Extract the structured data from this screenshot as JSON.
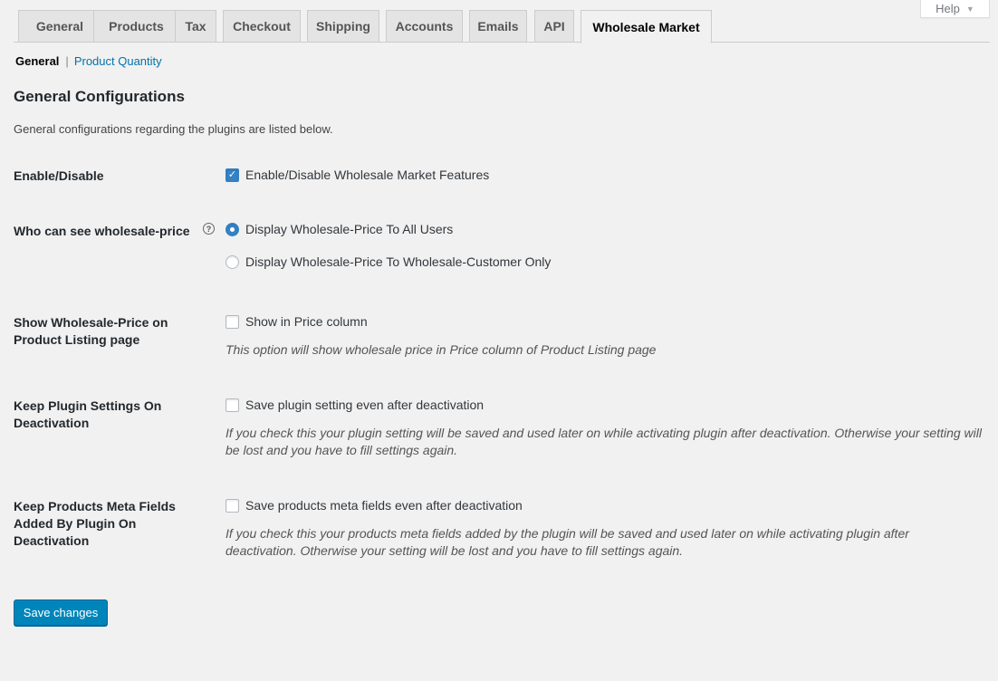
{
  "help": {
    "label": "Help"
  },
  "tabs": [
    {
      "label": "General",
      "active": false
    },
    {
      "label": "Products",
      "active": false
    },
    {
      "label": "Tax",
      "active": false
    },
    {
      "label": "Checkout",
      "active": false
    },
    {
      "label": "Shipping",
      "active": false
    },
    {
      "label": "Accounts",
      "active": false
    },
    {
      "label": "Emails",
      "active": false
    },
    {
      "label": "API",
      "active": false
    },
    {
      "label": "Wholesale Market",
      "active": true
    }
  ],
  "subnav": {
    "current": "General",
    "separator": "|",
    "link": "Product Quantity"
  },
  "section": {
    "title": "General Configurations",
    "description": "General configurations regarding the plugins are listed below."
  },
  "settings": {
    "enable": {
      "label": "Enable/Disable",
      "option": "Enable/Disable Wholesale Market Features",
      "checked": true
    },
    "who_can_see": {
      "label": "Who can see wholesale-price",
      "help_icon": "?",
      "options": [
        {
          "label": "Display Wholesale-Price To All Users",
          "selected": true
        },
        {
          "label": "Display Wholesale-Price To Wholesale-Customer Only",
          "selected": false
        }
      ]
    },
    "show_listing": {
      "label": "Show Wholesale-Price on Product Listing page",
      "option": "Show in Price column",
      "checked": false,
      "description": "This option will show wholesale price in Price column of Product Listing page"
    },
    "keep_settings": {
      "label": "Keep Plugin Settings On Deactivation",
      "option": "Save plugin setting even after deactivation",
      "checked": false,
      "description": "If you check this your plugin setting will be saved and used later on while activating plugin after deactivation. Otherwise your setting will be lost and you have to fill settings again."
    },
    "keep_meta": {
      "label": "Keep Products Meta Fields Added By Plugin On Deactivation",
      "option": "Save products meta fields even after deactivation",
      "checked": false,
      "description": "If you check this your products meta fields added by the plugin will be saved and used later on while activating plugin after deactivation. Otherwise your setting will be lost and you have to fill settings again."
    }
  },
  "save_button": {
    "label": "Save changes"
  },
  "colors": {
    "accent": "#0085ba",
    "checkbox_checked": "#3582c4",
    "link": "#0073aa",
    "background": "#f1f1f1"
  }
}
